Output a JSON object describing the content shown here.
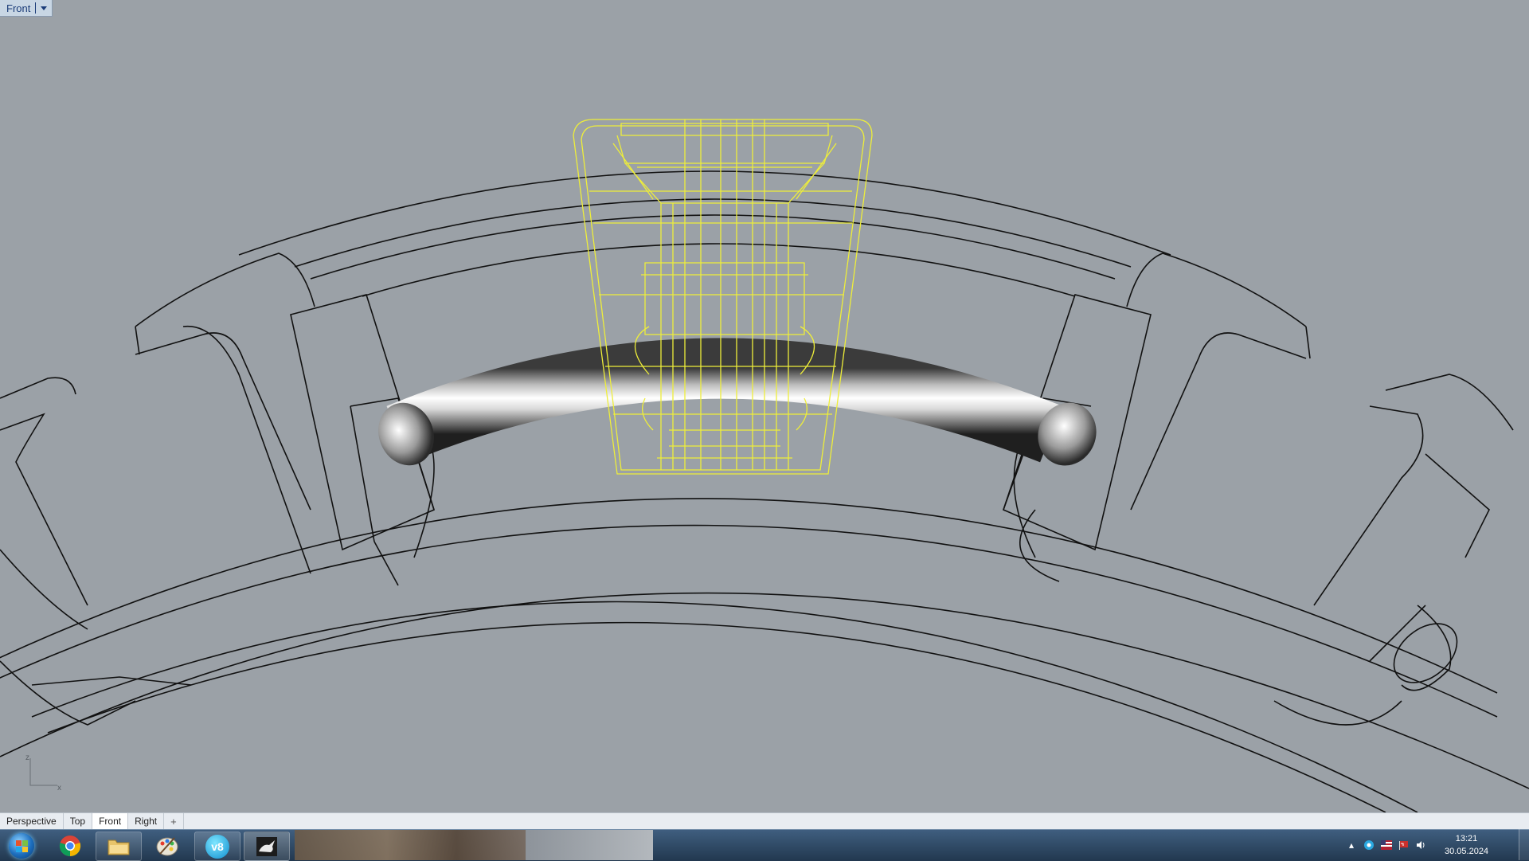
{
  "viewport": {
    "title": "Front",
    "dropdown_icon": "chevron-down-icon",
    "axis_labels": {
      "vertical": "z",
      "horizontal": "x"
    }
  },
  "viewport_tabs": [
    {
      "label": "Perspective",
      "active": false
    },
    {
      "label": "Top",
      "active": false
    },
    {
      "label": "Front",
      "active": true
    },
    {
      "label": "Right",
      "active": false
    },
    {
      "label": "+",
      "icon": "add-tab-icon"
    }
  ],
  "taskbar": {
    "start_icon": "windows-start-orb-icon",
    "pinned": [
      {
        "name": "chrome",
        "icon": "chrome-icon"
      },
      {
        "name": "explorer",
        "icon": "folder-icon"
      },
      {
        "name": "paint",
        "icon": "palette-icon"
      },
      {
        "name": "v8",
        "icon": "v8-icon",
        "label": "v8"
      },
      {
        "name": "rhino",
        "icon": "rhino-icon"
      }
    ],
    "tray_icons": [
      "up-arrow-icon",
      "network-icon",
      "language-flag-icon",
      "flag-icon",
      "volume-icon"
    ],
    "clock": {
      "time": "13:21",
      "date": "30.05.2024"
    }
  },
  "colors": {
    "viewport_bg": "#9ba1a7",
    "wire_black": "#111111",
    "wire_selected": "#f0f040",
    "taskbar": "#2c4763"
  }
}
